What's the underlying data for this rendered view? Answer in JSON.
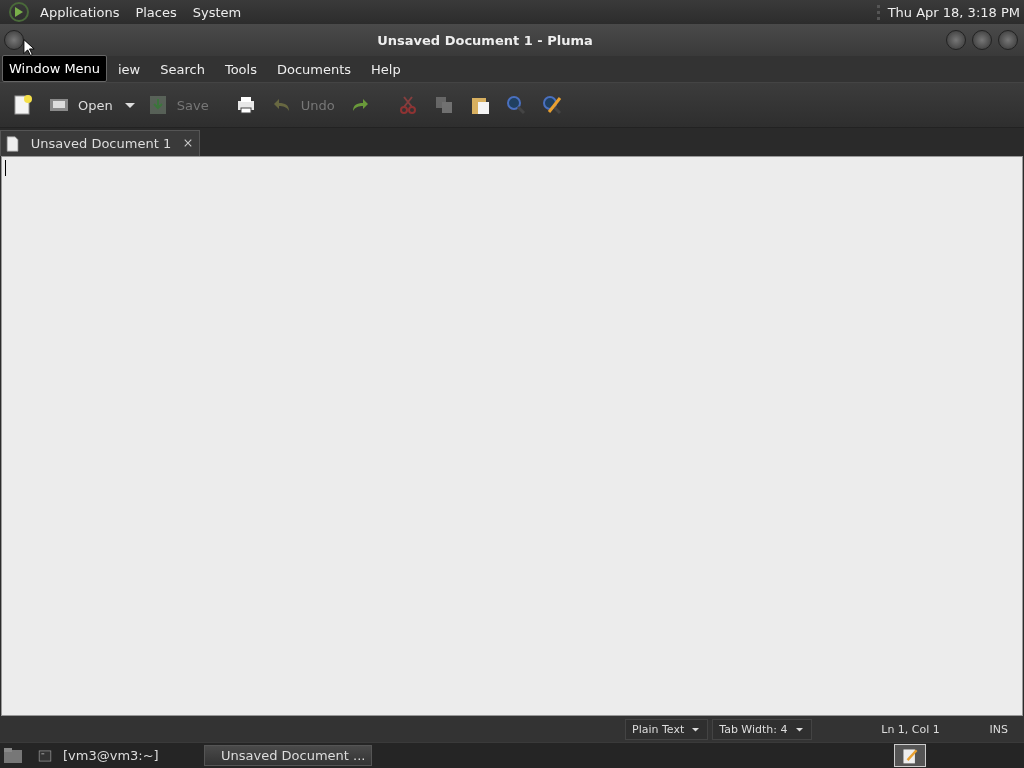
{
  "top_panel": {
    "menus": [
      "Applications",
      "Places",
      "System"
    ],
    "clock": "Thu Apr 18,  3:18 PM"
  },
  "window": {
    "title": "Unsaved Document 1 - Pluma"
  },
  "tooltip": "Window Menu",
  "menu_bar": [
    "iew",
    "Search",
    "Tools",
    "Documents",
    "Help"
  ],
  "toolbar": [
    {
      "kind": "new",
      "disabled": false
    },
    {
      "kind": "open",
      "label": "Open",
      "disabled": false
    },
    {
      "kind": "save",
      "label": "Save",
      "disabled": true
    },
    {
      "kind": "print",
      "disabled": false
    },
    {
      "kind": "undo",
      "label": "Undo",
      "disabled": true
    },
    {
      "kind": "redo",
      "disabled": false
    },
    {
      "kind": "cut",
      "disabled": true
    },
    {
      "kind": "copy",
      "disabled": true
    },
    {
      "kind": "paste",
      "disabled": false
    },
    {
      "kind": "find",
      "disabled": false
    },
    {
      "kind": "replace",
      "disabled": false
    }
  ],
  "tabs": [
    {
      "label": "Unsaved Document 1",
      "selected": true
    }
  ],
  "status_bar": {
    "language": "Plain Text",
    "tab_width": "Tab Width:  4",
    "position": "Ln 1, Col 1",
    "mode": "INS"
  },
  "taskbar": {
    "tasks": [
      {
        "kind": "terminal",
        "label": "[vm3@vm3:~]",
        "selected": false
      },
      {
        "kind": "editor",
        "label": "Unsaved Document ...",
        "selected": true
      }
    ]
  }
}
